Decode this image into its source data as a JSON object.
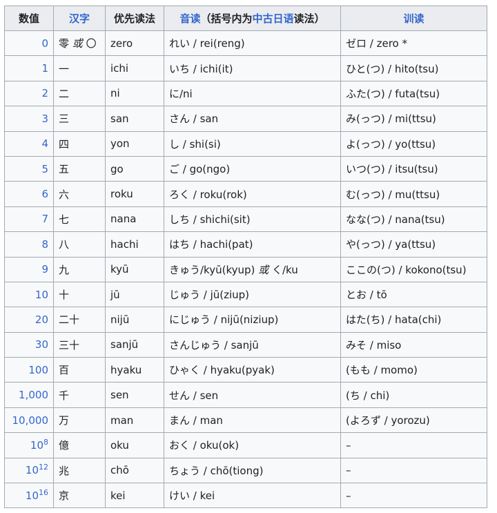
{
  "table": {
    "headers": {
      "value": "数值",
      "kanji": "汉字",
      "preferred": "优先读法",
      "on_link": "音读",
      "on_paren_open": "（括号内为",
      "on_mc_link": "中古日语",
      "on_paren_close": "读法）",
      "kun": "训读"
    },
    "rows": [
      {
        "value": "0",
        "kanji": "零",
        "kanji_or": "或",
        "kanji_alt": "〇",
        "preferred": "zero",
        "on": "れい / rei(reng)",
        "kun": "ゼロ / zero *"
      },
      {
        "value": "1",
        "kanji": "一",
        "preferred": "ichi",
        "on": "いち / ichi(it)",
        "kun": "ひと(つ) / hito(tsu)"
      },
      {
        "value": "2",
        "kanji": "二",
        "preferred": "ni",
        "on": "に/ni",
        "kun": "ふた(つ) / futa(tsu)"
      },
      {
        "value": "3",
        "kanji": "三",
        "preferred": "san",
        "on": "さん / san",
        "kun": "み(っつ) / mi(ttsu)"
      },
      {
        "value": "4",
        "kanji": "四",
        "preferred": "yon",
        "on": "し / shi(si)",
        "kun": "よ(っつ) / yo(ttsu)"
      },
      {
        "value": "5",
        "kanji": "五",
        "preferred": "go",
        "on": "ご / go(ngo)",
        "kun": "いつ(つ) / itsu(tsu)"
      },
      {
        "value": "6",
        "kanji": "六",
        "preferred": "roku",
        "on": "ろく / roku(rok)",
        "kun": "む(っつ) / mu(ttsu)"
      },
      {
        "value": "7",
        "kanji": "七",
        "preferred": "nana",
        "on": "しち / shichi(sit)",
        "kun": "なな(つ) / nana(tsu)"
      },
      {
        "value": "8",
        "kanji": "八",
        "preferred": "hachi",
        "on": "はち / hachi(pat)",
        "kun": "や(っつ) / ya(ttsu)"
      },
      {
        "value": "9",
        "kanji": "九",
        "preferred": "kyū",
        "on": "きゅう/kyū(kyup)",
        "on_or": "或",
        "on_alt": "く/ku",
        "kun": "ここの(つ) / kokono(tsu)"
      },
      {
        "value": "10",
        "kanji": "十",
        "preferred": "jū",
        "on": "じゅう / jū(ziup)",
        "kun": "とお / tō"
      },
      {
        "value": "20",
        "kanji": "二十",
        "preferred": "nijū",
        "on": "にじゅう / nijū(niziup)",
        "kun": "はた(ち) / hata(chi)"
      },
      {
        "value": "30",
        "kanji": "三十",
        "preferred": "sanjū",
        "on": "さんじゅう / sanjū",
        "kun": "みそ / miso"
      },
      {
        "value": "100",
        "kanji": "百",
        "preferred": "hyaku",
        "on": "ひゃく / hyaku(pyak)",
        "kun": "(もも / momo)"
      },
      {
        "value": "1,000",
        "kanji": "千",
        "preferred": "sen",
        "on": "せん / sen",
        "kun": "(ち / chi)"
      },
      {
        "value": "10,000",
        "kanji": "万",
        "preferred": "man",
        "on": "まん / man",
        "kun": "(よろず / yorozu)"
      },
      {
        "value": "10",
        "value_exp": "8",
        "kanji": "億",
        "preferred": "oku",
        "on": "おく / oku(ok)",
        "kun": "–"
      },
      {
        "value": "10",
        "value_exp": "12",
        "kanji": "兆",
        "preferred": "chō",
        "on": "ちょう / chō(tiong)",
        "kun": "–"
      },
      {
        "value": "10",
        "value_exp": "16",
        "kanji": "京",
        "preferred": "kei",
        "on": "けい / kei",
        "kun": "–"
      }
    ]
  }
}
